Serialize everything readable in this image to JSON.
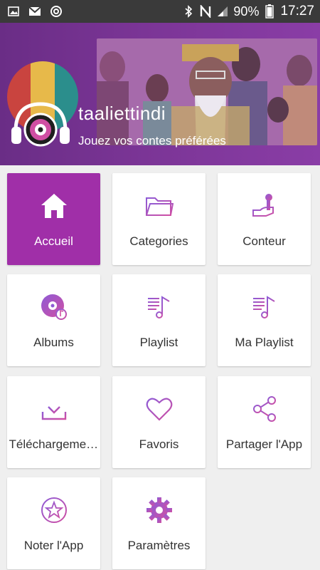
{
  "status_bar": {
    "battery": "90%",
    "time": "17:27",
    "left_icons": [
      "gallery-icon",
      "gmail-icon",
      "sync-icon"
    ],
    "right_icons": [
      "bluetooth-icon",
      "nfc-icon",
      "signal-icon",
      "battery-icon"
    ]
  },
  "header": {
    "app_name": "taaliettindi",
    "tagline": "Jouez vos contes préférées",
    "avatar_colors": [
      "#c9443f",
      "#e7b94a",
      "#2b8e8c"
    ]
  },
  "colors": {
    "accent": "#a02fa8",
    "icon_gradient_start": "#8e5bd6",
    "icon_gradient_end": "#d04fa3"
  },
  "menu": {
    "items": [
      {
        "label": "Accueil",
        "icon": "home-icon",
        "active": true
      },
      {
        "label": "Categories",
        "icon": "folder-icon",
        "active": false
      },
      {
        "label": "Conteur",
        "icon": "microphone-hand-icon",
        "active": false
      },
      {
        "label": "Albums",
        "icon": "album-disc-icon",
        "active": false
      },
      {
        "label": "Playlist",
        "icon": "playlist-icon",
        "active": false
      },
      {
        "label": "Ma Playlist",
        "icon": "my-playlist-icon",
        "active": false
      },
      {
        "label": "Téléchargements",
        "icon": "download-icon",
        "active": false
      },
      {
        "label": "Favoris",
        "icon": "heart-icon",
        "active": false
      },
      {
        "label": "Partager l'App",
        "icon": "share-icon",
        "active": false
      },
      {
        "label": "Noter l'App",
        "icon": "star-circle-icon",
        "active": false
      },
      {
        "label": "Paramètres",
        "icon": "gear-icon",
        "active": false
      }
    ]
  }
}
